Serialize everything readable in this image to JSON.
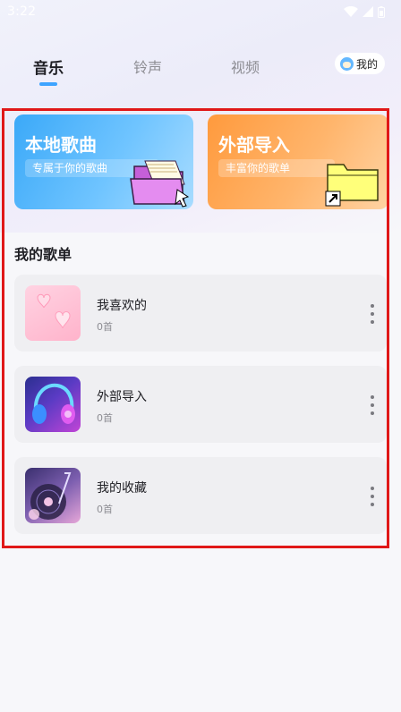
{
  "status_bar": {
    "time": "3:22",
    "icons": [
      "wifi-icon",
      "signal-icon",
      "battery-icon"
    ]
  },
  "tabs": [
    {
      "label": "音乐",
      "active": true
    },
    {
      "label": "铃声",
      "active": false
    },
    {
      "label": "视频",
      "active": false
    }
  ],
  "mine_button": {
    "label": "我的",
    "icon": "avatar-icon"
  },
  "cards": {
    "local": {
      "title": "本地歌曲",
      "subtitle": "专属于你的歌曲",
      "icon": "folder-icon"
    },
    "import": {
      "title": "外部导入",
      "subtitle": "丰富你的歌单",
      "icon": "folder-shortcut-icon"
    }
  },
  "section_title": "我的歌单",
  "playlists": [
    {
      "name": "我喜欢的",
      "count": "0首",
      "cover": "hearts-cover"
    },
    {
      "name": "外部导入",
      "count": "0首",
      "cover": "headphones-cover"
    },
    {
      "name": "我的收藏",
      "count": "0首",
      "cover": "vinyl-cover"
    }
  ],
  "colors": {
    "tab_indicator": "#3ea4ff",
    "local_card": "#3ba9f8",
    "import_card": "#ff9a3d",
    "highlight": "#e01818"
  }
}
